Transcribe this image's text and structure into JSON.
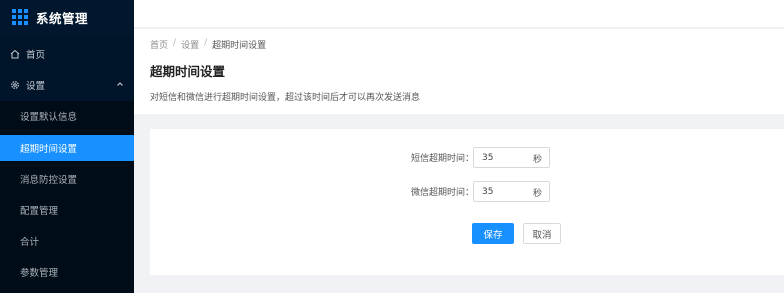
{
  "app": {
    "title": "系统管理"
  },
  "sidebar": {
    "home_label": "首页",
    "settings_label": "设置",
    "items": [
      {
        "label": "设置默认信息"
      },
      {
        "label": "超期时间设置"
      },
      {
        "label": "消息防控设置"
      },
      {
        "label": "配置管理"
      },
      {
        "label": "合计"
      },
      {
        "label": "参数管理"
      }
    ],
    "active_item": "超期时间设置"
  },
  "breadcrumb": {
    "items": [
      "首页",
      "设置",
      "超期时间设置"
    ],
    "separator": "/"
  },
  "page": {
    "title": "超期时间设置",
    "description": "对短信和微信进行超期时间设置，超过该时间后才可以再次发送消息"
  },
  "form": {
    "sms_label": "短信超期时间：",
    "sms_value": "35",
    "wechat_label": "微信超期时间：",
    "wechat_value": "35",
    "unit": "秒",
    "save_label": "保存",
    "cancel_label": "取消"
  },
  "colors": {
    "sidebar_bg": "#001529",
    "accent": "#1890ff",
    "page_bg": "#f0f2f5"
  }
}
